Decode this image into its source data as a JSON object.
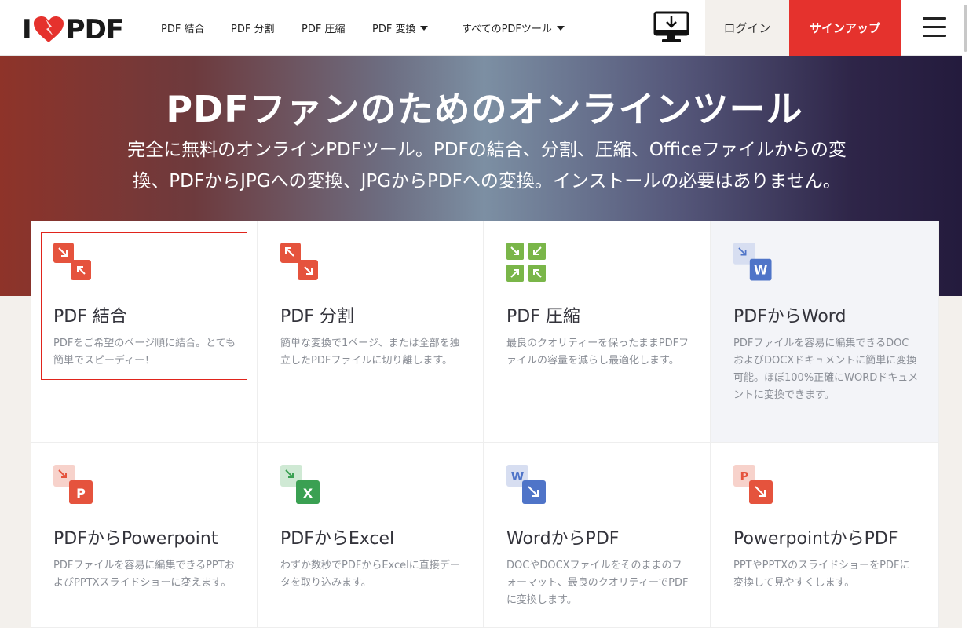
{
  "nav": {
    "logo": {
      "left": "I",
      "right": "PDF"
    },
    "items": [
      "PDF 結合",
      "PDF 分割",
      "PDF 圧縮",
      "PDF 変換",
      "すべてのPDFツール"
    ],
    "login": "ログイン",
    "signup": "サインアップ",
    "icons": [
      "desktop-download-icon",
      "hamburger-menu-icon"
    ]
  },
  "hero": {
    "title": "PDFファンのためのオンラインツール",
    "subtitle_line1": "完全に無料のオンラインPDFツール。PDFの結合、分割、圧縮、Officeファイルからの変",
    "subtitle_line2": "換、PDFからJPGへの変換、JPGからPDFへの変換。インストールの必要はありません。"
  },
  "tools": [
    {
      "title": "PDF 結合",
      "desc": "PDFをご希望のページ順に結合。とても簡単でスピーディー！",
      "icon": "merge-icon",
      "color": "#e5533d"
    },
    {
      "title": "PDF 分割",
      "desc": "簡単な変換で1ページ、または全部を独立したPDFファイルに切り離します。",
      "icon": "split-icon",
      "color": "#e5533d"
    },
    {
      "title": "PDF 圧縮",
      "desc": "最良のクオリティーを保ったままPDFファイルの容量を減らし最適化します。",
      "icon": "compress-icon",
      "color": "#7ab649"
    },
    {
      "title": "PDFからWord",
      "desc": "PDFファイルを容易に編集できるDOCおよびDOCXドキュメントに簡単に変換可能。ほぼ100%正確にWORDドキュメントに変換できます。",
      "icon": "pdf-to-word-icon",
      "color": "#4f74c8"
    },
    {
      "title": "PDFからPowerpoint",
      "desc": "PDFファイルを容易に編集できるPPTおよびPPTXスライドショーに変えます。",
      "icon": "pdf-to-powerpoint-icon",
      "color": "#e5533d"
    },
    {
      "title": "PDFからExcel",
      "desc": "わずか数秒でPDFからExcelに直接データを取り込みます。",
      "icon": "pdf-to-excel-icon",
      "color": "#3aa052"
    },
    {
      "title": "WordからPDF",
      "desc": "DOCやDOCXファイルをそのままのフォーマット、最良のクオリティーでPDFに変換します。",
      "icon": "word-to-pdf-icon",
      "color": "#4f74c8"
    },
    {
      "title": "PowerpointからPDF",
      "desc": "PPTやPPTXのスライドショーをPDFに変換して見やすくします。",
      "icon": "powerpoint-to-pdf-icon",
      "color": "#e5533d"
    }
  ]
}
